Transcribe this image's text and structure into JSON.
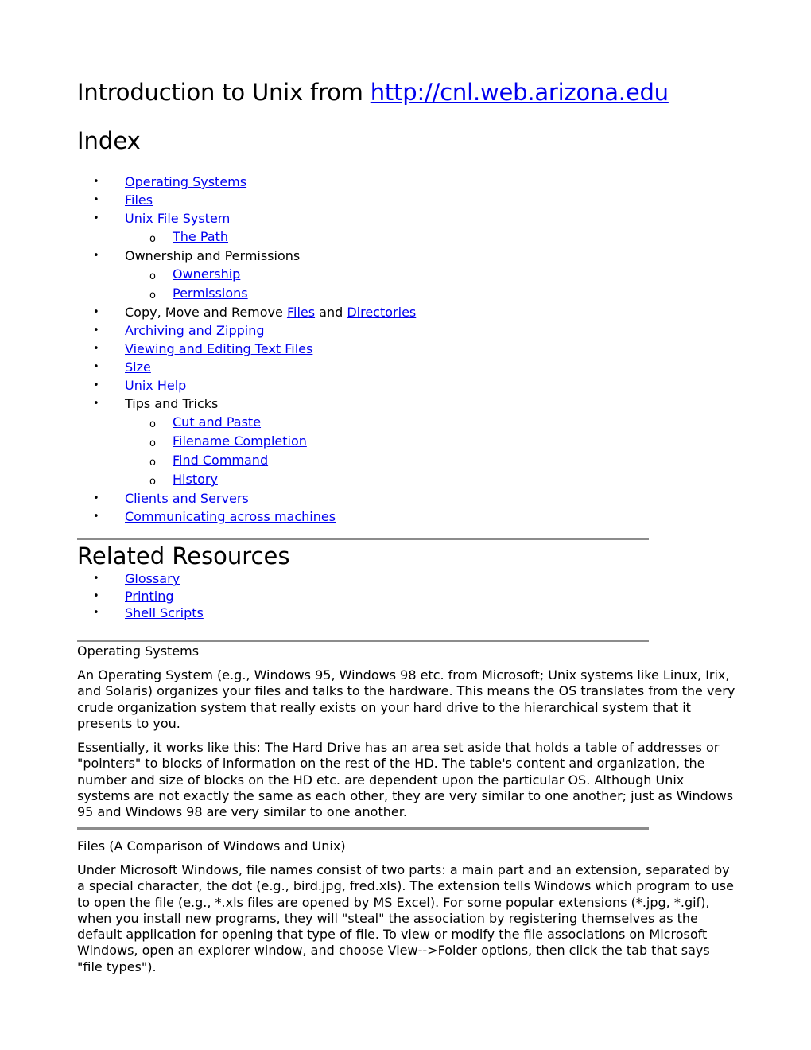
{
  "header": {
    "title_prefix": "Introduction to Unix from ",
    "title_link": "http://cnl.web.arizona.edu"
  },
  "index": {
    "heading": "Index",
    "items": [
      {
        "type": "link",
        "label": "Operating Systems"
      },
      {
        "type": "link",
        "label": "Files"
      },
      {
        "type": "link",
        "label": "Unix File System"
      },
      {
        "type": "sublink",
        "label": "The Path"
      },
      {
        "type": "text",
        "label": "Ownership and Permissions"
      },
      {
        "type": "sublink",
        "label": "Ownership"
      },
      {
        "type": "sublink",
        "label": "Permissions"
      },
      {
        "type": "mixed",
        "prefix": "Copy, Move and Remove ",
        "link1": "Files",
        "middle": " and ",
        "link2": "Directories"
      },
      {
        "type": "link",
        "label": "Archiving and Zipping"
      },
      {
        "type": "link",
        "label": "Viewing and Editing Text Files"
      },
      {
        "type": "link",
        "label": "Size"
      },
      {
        "type": "link",
        "label": "Unix Help"
      },
      {
        "type": "text",
        "label": "Tips and Tricks"
      },
      {
        "type": "sublink",
        "label": "Cut and Paste"
      },
      {
        "type": "sublink",
        "label": "Filename Completion"
      },
      {
        "type": "sublink",
        "label": "Find Command"
      },
      {
        "type": "sublink",
        "label": "History"
      },
      {
        "type": "link",
        "label": "Clients and Servers"
      },
      {
        "type": "link",
        "label": "Communicating across machines"
      }
    ]
  },
  "related": {
    "heading": "Related Resources",
    "items": [
      "Glossary",
      "Printing",
      "Shell Scripts"
    ]
  },
  "sections": {
    "os": {
      "title": "Operating Systems",
      "paragraphs": [
        "An Operating System (e.g., Windows 95, Windows 98 etc. from Microsoft; Unix systems like Linux, Irix, and Solaris) organizes your files and talks to the hardware. This means the OS translates from the very crude organization system that really exists on your hard drive to the hierarchical system that it presents to you.",
        "Essentially, it works like this: The Hard Drive has an area set aside that holds a table of addresses or \"pointers\" to blocks of information on the rest of the HD. The table's content and organization, the number and size of blocks on the HD etc. are dependent upon the particular OS. Although Unix systems are not exactly the same as each other, they are very similar to one another; just as Windows 95 and Windows 98 are very similar to one another."
      ]
    },
    "files": {
      "title": "Files (A Comparison of Windows and Unix)",
      "paragraphs": [
        "Under Microsoft Windows, file names consist of two parts: a main part and an extension, separated by a special character, the dot (e.g., bird.jpg, fred.xls). The extension tells Windows which program to use to open the file (e.g., *.xls files are opened by MS Excel). For some popular extensions (*.jpg, *.gif), when you install new programs, they will \"steal\" the association by registering themselves as the default application for opening that type of file. To view or modify the file associations on Microsoft Windows, open an explorer window, and choose View-->Folder options, then click the tab that says \"file types\")."
      ]
    }
  },
  "glyphs": {
    "bullet": "•",
    "circle": "o"
  }
}
